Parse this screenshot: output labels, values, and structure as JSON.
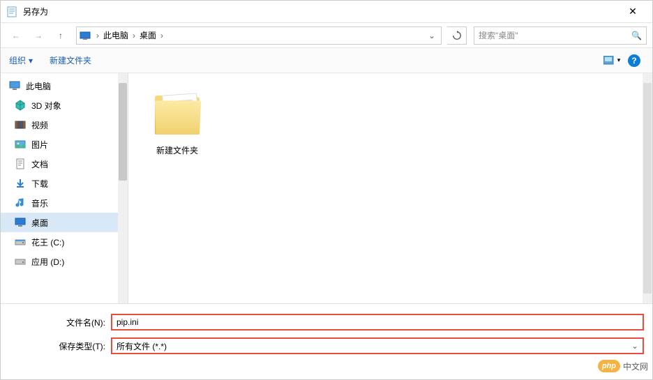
{
  "window": {
    "title": "另存为",
    "close": "✕"
  },
  "nav": {
    "back": "←",
    "forward": "→",
    "up": "↑",
    "breadcrumbs": [
      "此电脑",
      "桌面"
    ],
    "refresh": "↻",
    "search_placeholder": "搜索\"桌面\""
  },
  "toolbar": {
    "organize": "组织",
    "new_folder": "新建文件夹"
  },
  "sidebar": {
    "root": "此电脑",
    "items": [
      {
        "icon": "3d-icon",
        "label": "3D 对象"
      },
      {
        "icon": "video-icon",
        "label": "视频"
      },
      {
        "icon": "pictures-icon",
        "label": "图片"
      },
      {
        "icon": "documents-icon",
        "label": "文档"
      },
      {
        "icon": "downloads-icon",
        "label": "下载"
      },
      {
        "icon": "music-icon",
        "label": "音乐"
      },
      {
        "icon": "desktop-icon",
        "label": "桌面",
        "selected": true
      },
      {
        "icon": "drive-icon",
        "label": "花王 (C:)"
      },
      {
        "icon": "drive-icon",
        "label": "应用 (D:)"
      }
    ]
  },
  "content": {
    "items": [
      {
        "name": "新建文件夹",
        "type": "folder"
      }
    ]
  },
  "form": {
    "filename_label": "文件名(N):",
    "filename_value": "pip.ini",
    "filetype_label": "保存类型(T):",
    "filetype_value": "所有文件 (*.*)"
  },
  "watermark": {
    "badge": "php",
    "text": "中文网"
  }
}
